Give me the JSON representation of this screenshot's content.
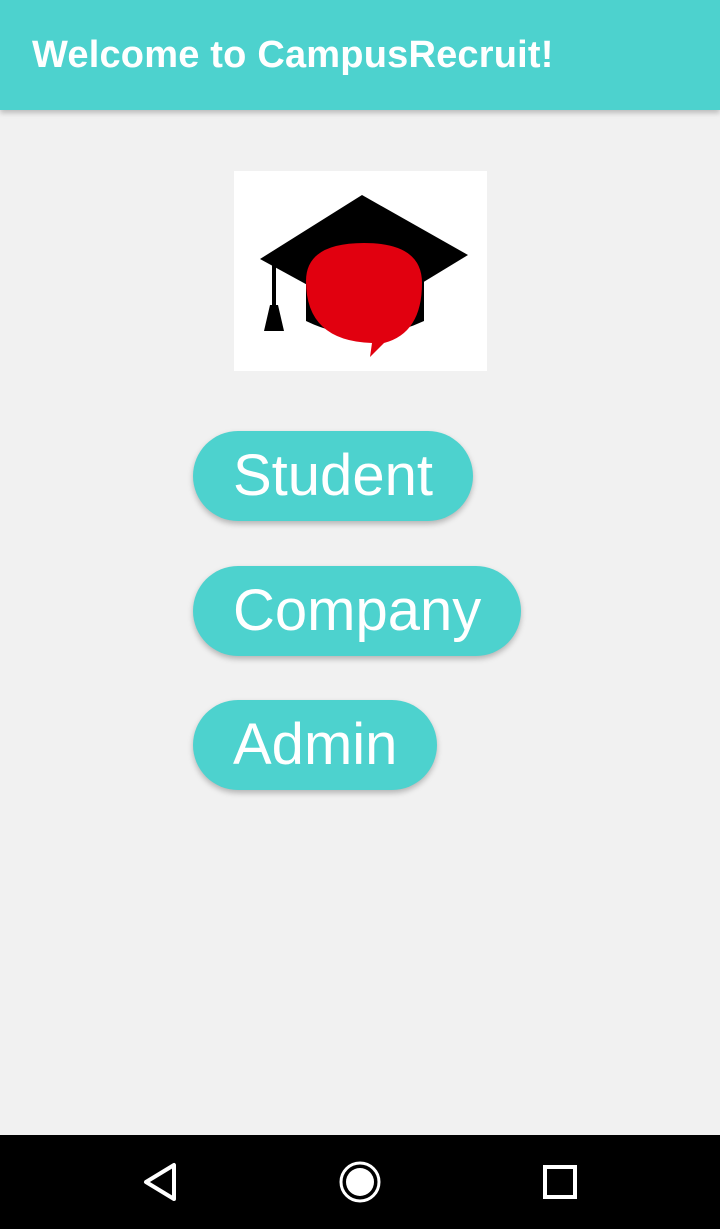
{
  "app_bar": {
    "title": "Welcome to CampusRecruit!",
    "background_color": "#4dd2ce"
  },
  "logo": {
    "icon": "graduation-cap-chat-bubble-logo",
    "colors": {
      "cap": "#000000",
      "bubble": "#e1000f"
    }
  },
  "roles": {
    "student_label": "Student",
    "company_label": "Company",
    "admin_label": "Admin",
    "button_color": "#4dd2ce"
  },
  "system_nav": {
    "back_icon": "back-triangle-icon",
    "home_icon": "home-circle-icon",
    "recents_icon": "recents-square-icon"
  }
}
